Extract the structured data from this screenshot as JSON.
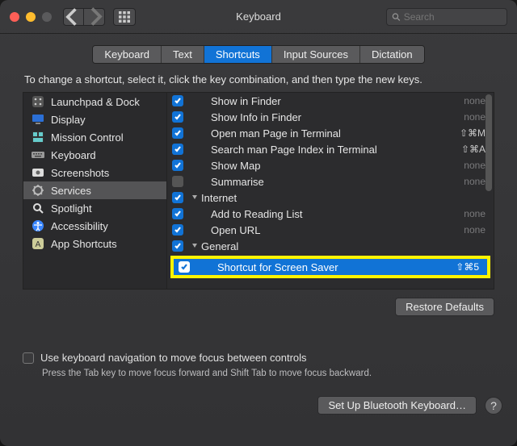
{
  "window": {
    "title": "Keyboard"
  },
  "search": {
    "placeholder": "Search"
  },
  "tabs": [
    {
      "label": "Keyboard"
    },
    {
      "label": "Text"
    },
    {
      "label": "Shortcuts",
      "selected": true
    },
    {
      "label": "Input Sources"
    },
    {
      "label": "Dictation"
    }
  ],
  "instruction": "To change a shortcut, select it, click the key combination, and then type the new keys.",
  "sidebar": {
    "items": [
      {
        "label": "Launchpad & Dock",
        "icon": "launchpad"
      },
      {
        "label": "Display",
        "icon": "display"
      },
      {
        "label": "Mission Control",
        "icon": "mission"
      },
      {
        "label": "Keyboard",
        "icon": "keyboard"
      },
      {
        "label": "Screenshots",
        "icon": "screenshots"
      },
      {
        "label": "Services",
        "icon": "services",
        "selected": true
      },
      {
        "label": "Spotlight",
        "icon": "spotlight"
      },
      {
        "label": "Accessibility",
        "icon": "accessibility"
      },
      {
        "label": "App Shortcuts",
        "icon": "appshortcuts"
      }
    ]
  },
  "shortcuts": {
    "rows": [
      {
        "checked": true,
        "label": "Show in Finder",
        "indent": 2,
        "key": "none"
      },
      {
        "checked": true,
        "label": "Show Info in Finder",
        "indent": 2,
        "key": "none"
      },
      {
        "checked": true,
        "label": "Open man Page in Terminal",
        "indent": 2,
        "key": "⇧⌘M"
      },
      {
        "checked": true,
        "label": "Search man Page Index in Terminal",
        "indent": 2,
        "key": "⇧⌘A"
      },
      {
        "checked": true,
        "label": "Show Map",
        "indent": 2,
        "key": "none"
      },
      {
        "checked": false,
        "label": "Summarise",
        "indent": 2,
        "key": "none"
      },
      {
        "group": true,
        "checked": true,
        "label": "Internet",
        "indent": 1
      },
      {
        "checked": true,
        "label": "Add to Reading List",
        "indent": 2,
        "key": "none"
      },
      {
        "checked": true,
        "label": "Open URL",
        "indent": 2,
        "key": "none"
      },
      {
        "group": true,
        "checked": true,
        "label": "General",
        "indent": 1
      }
    ],
    "highlighted": {
      "checked": true,
      "label": "Shortcut for Screen Saver",
      "key": "⇧⌘5"
    }
  },
  "buttons": {
    "restore": "Restore Defaults",
    "bluetooth": "Set Up Bluetooth Keyboard…"
  },
  "footer": {
    "checkbox_label": "Use keyboard navigation to move focus between controls",
    "note": "Press the Tab key to move focus forward and Shift Tab to move focus backward."
  }
}
